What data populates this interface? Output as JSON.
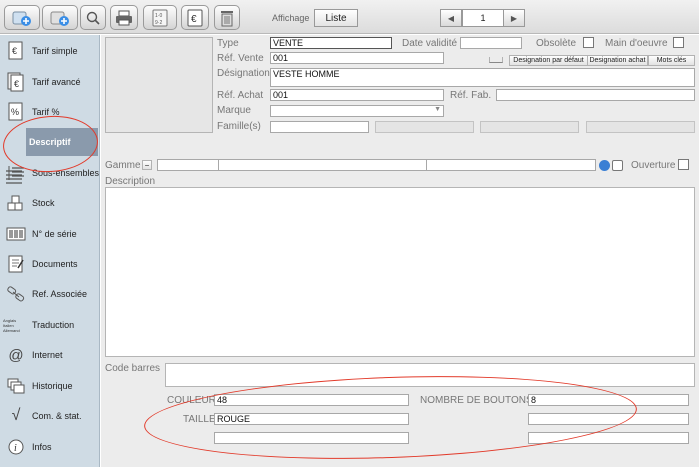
{
  "toolbar": {
    "affichage_label": "Affichage",
    "liste_label": "Liste",
    "pager_value": "1",
    "icons": [
      "add-icon",
      "add-variant-icon",
      "search-icon",
      "print-icon",
      "calculator-icon",
      "euro-icon",
      "trash-icon"
    ]
  },
  "sidebar": {
    "items": [
      {
        "label": "Tarif simple",
        "icon": "euro-doc-icon"
      },
      {
        "label": "Tarif avancé",
        "icon": "euro-doc-icon"
      },
      {
        "label": "Tarif %",
        "icon": "percent-doc-icon"
      },
      {
        "label": "Descriptif",
        "icon": "list-icon"
      },
      {
        "label": "Sous-ensembles",
        "icon": "list-icon"
      },
      {
        "label": "Stock",
        "icon": "stock-icon"
      },
      {
        "label": "N° de série",
        "icon": "barcode-icon"
      },
      {
        "label": "Documents",
        "icon": "document-icon"
      },
      {
        "label": "Ref. Associée",
        "icon": "link-icon"
      },
      {
        "label": "Traduction",
        "icon": "translate-icon",
        "icon_text": [
          "Anglais",
          "Italien",
          "Allemand"
        ]
      },
      {
        "label": "Internet",
        "icon": "at-icon"
      },
      {
        "label": "Historique",
        "icon": "history-icon"
      },
      {
        "label": "Com. & stat.",
        "icon": "sqrt-icon"
      },
      {
        "label": "Infos",
        "icon": "info-icon"
      }
    ]
  },
  "form": {
    "type_label": "Type",
    "type_value": "VENTE",
    "date_validite_label": "Date validité",
    "date_validite_value": "",
    "obsolete_label": "Obsolète",
    "main_oeuvre_label": "Main d'oeuvre",
    "ref_vente_label": "Réf. Vente",
    "ref_vente_value": "001",
    "btn_designation_defaut": "Designation par défaut",
    "btn_designation_achat": "Designation achat",
    "btn_mots_cles": "Mots clés",
    "designation_label": "Désignation",
    "designation_value": "VESTE HOMME",
    "ref_achat_label": "Réf. Achat",
    "ref_achat_value": "001",
    "ref_fab_label": "Réf. Fab.",
    "ref_fab_value": "",
    "marque_label": "Marque",
    "marque_value": "",
    "familles_label": "Famille(s)",
    "gamme_label": "Gamme",
    "ouverture_label": "Ouverture",
    "description_label": "Description",
    "description_value": "",
    "code_barres_label": "Code barres",
    "code_barres_value": "",
    "couleur_label": "COULEUR",
    "couleur_value": "48",
    "nombre_boutons_label": "NOMBRE DE BOUTONS",
    "nombre_boutons_value": "8",
    "taille_label": "TAILLE",
    "taille_value": "ROUGE"
  },
  "colors": {
    "sidebar_bg": "#cfdbe4",
    "sidebar_active": "#8a9aac",
    "annotation": "#e23a2a",
    "main_bg": "#ececec"
  }
}
